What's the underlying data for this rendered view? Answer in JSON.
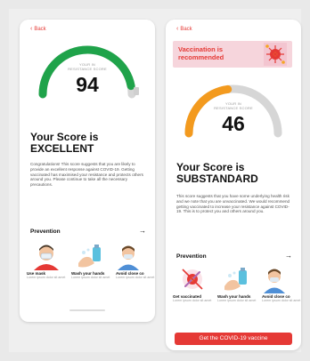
{
  "left_screen": {
    "back_label": "Back",
    "gauge_caption": [
      "YOUR IN",
      "RESISTANCE SCORE"
    ],
    "score": "94",
    "heading_line1": "Your Score is",
    "heading_line2": "EXCELLENT",
    "description": "Congratulations! This score suggests that you are likely to provide an excellent response against COVID-19. Getting vaccinated has maximised your resistance and protects others around you. Please continue to take all the necessary precautions.",
    "prevention_title": "Prevention",
    "cards": [
      {
        "label": "Use mask",
        "sub": "Lorem ipsum dolor sit amet"
      },
      {
        "label": "Wash your hands",
        "sub": "Lorem ipsum dolor sit amet"
      },
      {
        "label": "Avoid close co",
        "sub": "Lorem ipsum dolor sit amet"
      }
    ],
    "gauge_fraction": 0.94,
    "gauge_color": "#1fa34a"
  },
  "right_screen": {
    "back_label": "Back",
    "banner_text": "Vaccination is recommended",
    "gauge_caption": [
      "YOUR IN",
      "RESISTANCE SCORE"
    ],
    "score": "46",
    "heading_line1": "Your Score is",
    "heading_line2": "SUBSTANDARD",
    "description": "This score suggests that you have some underlying health risk and we note that you are unvaccinated. We would recommend getting vaccinated to increase your resistance against COVID-19. This is to protect you and others around you.",
    "prevention_title": "Prevention",
    "cards": [
      {
        "label": "Get vaccinated",
        "sub": "Lorem ipsum dolor sit amet"
      },
      {
        "label": "Wash your hands",
        "sub": "Lorem ipsum dolor sit amet"
      },
      {
        "label": "Avoid close co",
        "sub": "Lorem ipsum dolor sit amet"
      }
    ],
    "cta_label": "Get the COVID-19 vaccine",
    "gauge_fraction": 0.46,
    "gauge_color": "#f39a1e"
  },
  "colors": {
    "accent_red": "#e53935",
    "track_gray": "#d6d6d6"
  }
}
